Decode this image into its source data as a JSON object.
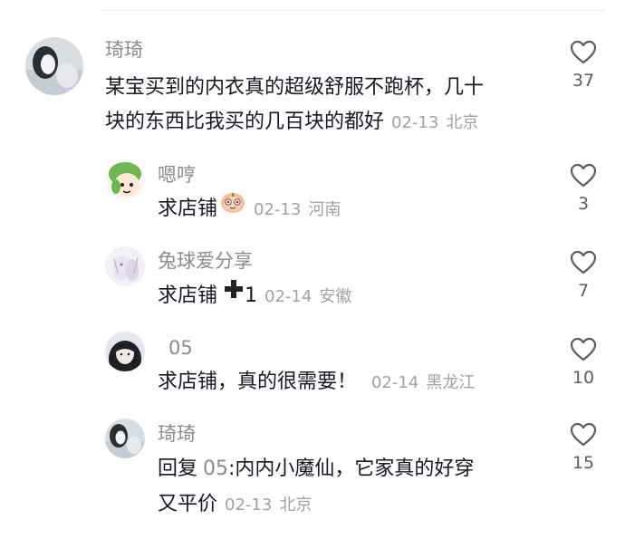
{
  "comments": [
    {
      "username": "琦琦",
      "text_line1": "某宝买到的内衣真的超级舒服不跑杯，几十",
      "text_line2": "块的东西比我买的几百块的都好",
      "date": "02-13",
      "location": "北京",
      "likes": "37"
    },
    {
      "username": "嗯哼",
      "text": "求店铺",
      "emoji": "peach-emoji-icon",
      "date": "02-13",
      "location": "河南",
      "likes": "3"
    },
    {
      "username": "兔球爱分享",
      "text": "求店铺",
      "emoji": "plus-emoji-icon",
      "text_suffix": "1",
      "date": "02-14",
      "location": "安徽",
      "likes": "7"
    },
    {
      "username": "05",
      "text": "求店铺，真的很需要！",
      "date": "02-14",
      "location": "黑龙江",
      "likes": "10"
    },
    {
      "username": "琦琦",
      "reply_prefix": "回复",
      "reply_to": "05",
      "text_line1": ":内内小魔仙，它家真的好穿",
      "text_line2": "又平价",
      "date": "02-13",
      "location": "北京",
      "likes": "15"
    }
  ],
  "colors": {
    "username": "#8a8b91",
    "text": "#161823",
    "meta": "#a0a1a6",
    "heart_outline": "#5c5d63"
  }
}
